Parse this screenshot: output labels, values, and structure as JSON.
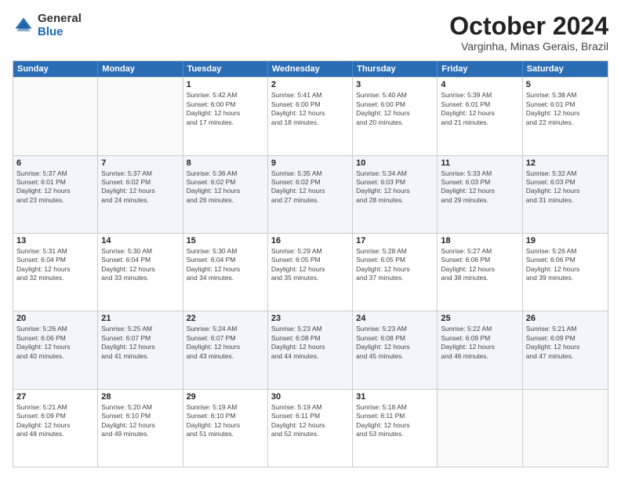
{
  "logo": {
    "general": "General",
    "blue": "Blue"
  },
  "title": "October 2024",
  "location": "Varginha, Minas Gerais, Brazil",
  "weekdays": [
    "Sunday",
    "Monday",
    "Tuesday",
    "Wednesday",
    "Thursday",
    "Friday",
    "Saturday"
  ],
  "weeks": [
    [
      {
        "day": "",
        "info": ""
      },
      {
        "day": "",
        "info": ""
      },
      {
        "day": "1",
        "info": "Sunrise: 5:42 AM\nSunset: 6:00 PM\nDaylight: 12 hours\nand 17 minutes."
      },
      {
        "day": "2",
        "info": "Sunrise: 5:41 AM\nSunset: 6:00 PM\nDaylight: 12 hours\nand 18 minutes."
      },
      {
        "day": "3",
        "info": "Sunrise: 5:40 AM\nSunset: 6:00 PM\nDaylight: 12 hours\nand 20 minutes."
      },
      {
        "day": "4",
        "info": "Sunrise: 5:39 AM\nSunset: 6:01 PM\nDaylight: 12 hours\nand 21 minutes."
      },
      {
        "day": "5",
        "info": "Sunrise: 5:38 AM\nSunset: 6:01 PM\nDaylight: 12 hours\nand 22 minutes."
      }
    ],
    [
      {
        "day": "6",
        "info": "Sunrise: 5:37 AM\nSunset: 6:01 PM\nDaylight: 12 hours\nand 23 minutes."
      },
      {
        "day": "7",
        "info": "Sunrise: 5:37 AM\nSunset: 6:02 PM\nDaylight: 12 hours\nand 24 minutes."
      },
      {
        "day": "8",
        "info": "Sunrise: 5:36 AM\nSunset: 6:02 PM\nDaylight: 12 hours\nand 26 minutes."
      },
      {
        "day": "9",
        "info": "Sunrise: 5:35 AM\nSunset: 6:02 PM\nDaylight: 12 hours\nand 27 minutes."
      },
      {
        "day": "10",
        "info": "Sunrise: 5:34 AM\nSunset: 6:03 PM\nDaylight: 12 hours\nand 28 minutes."
      },
      {
        "day": "11",
        "info": "Sunrise: 5:33 AM\nSunset: 6:03 PM\nDaylight: 12 hours\nand 29 minutes."
      },
      {
        "day": "12",
        "info": "Sunrise: 5:32 AM\nSunset: 6:03 PM\nDaylight: 12 hours\nand 31 minutes."
      }
    ],
    [
      {
        "day": "13",
        "info": "Sunrise: 5:31 AM\nSunset: 6:04 PM\nDaylight: 12 hours\nand 32 minutes."
      },
      {
        "day": "14",
        "info": "Sunrise: 5:30 AM\nSunset: 6:04 PM\nDaylight: 12 hours\nand 33 minutes."
      },
      {
        "day": "15",
        "info": "Sunrise: 5:30 AM\nSunset: 6:04 PM\nDaylight: 12 hours\nand 34 minutes."
      },
      {
        "day": "16",
        "info": "Sunrise: 5:29 AM\nSunset: 6:05 PM\nDaylight: 12 hours\nand 35 minutes."
      },
      {
        "day": "17",
        "info": "Sunrise: 5:28 AM\nSunset: 6:05 PM\nDaylight: 12 hours\nand 37 minutes."
      },
      {
        "day": "18",
        "info": "Sunrise: 5:27 AM\nSunset: 6:06 PM\nDaylight: 12 hours\nand 38 minutes."
      },
      {
        "day": "19",
        "info": "Sunrise: 5:26 AM\nSunset: 6:06 PM\nDaylight: 12 hours\nand 39 minutes."
      }
    ],
    [
      {
        "day": "20",
        "info": "Sunrise: 5:26 AM\nSunset: 6:06 PM\nDaylight: 12 hours\nand 40 minutes."
      },
      {
        "day": "21",
        "info": "Sunrise: 5:25 AM\nSunset: 6:07 PM\nDaylight: 12 hours\nand 41 minutes."
      },
      {
        "day": "22",
        "info": "Sunrise: 5:24 AM\nSunset: 6:07 PM\nDaylight: 12 hours\nand 43 minutes."
      },
      {
        "day": "23",
        "info": "Sunrise: 5:23 AM\nSunset: 6:08 PM\nDaylight: 12 hours\nand 44 minutes."
      },
      {
        "day": "24",
        "info": "Sunrise: 5:23 AM\nSunset: 6:08 PM\nDaylight: 12 hours\nand 45 minutes."
      },
      {
        "day": "25",
        "info": "Sunrise: 5:22 AM\nSunset: 6:09 PM\nDaylight: 12 hours\nand 46 minutes."
      },
      {
        "day": "26",
        "info": "Sunrise: 5:21 AM\nSunset: 6:09 PM\nDaylight: 12 hours\nand 47 minutes."
      }
    ],
    [
      {
        "day": "27",
        "info": "Sunrise: 5:21 AM\nSunset: 6:09 PM\nDaylight: 12 hours\nand 48 minutes."
      },
      {
        "day": "28",
        "info": "Sunrise: 5:20 AM\nSunset: 6:10 PM\nDaylight: 12 hours\nand 49 minutes."
      },
      {
        "day": "29",
        "info": "Sunrise: 5:19 AM\nSunset: 6:10 PM\nDaylight: 12 hours\nand 51 minutes."
      },
      {
        "day": "30",
        "info": "Sunrise: 5:19 AM\nSunset: 6:11 PM\nDaylight: 12 hours\nand 52 minutes."
      },
      {
        "day": "31",
        "info": "Sunrise: 5:18 AM\nSunset: 6:11 PM\nDaylight: 12 hours\nand 53 minutes."
      },
      {
        "day": "",
        "info": ""
      },
      {
        "day": "",
        "info": ""
      }
    ]
  ]
}
